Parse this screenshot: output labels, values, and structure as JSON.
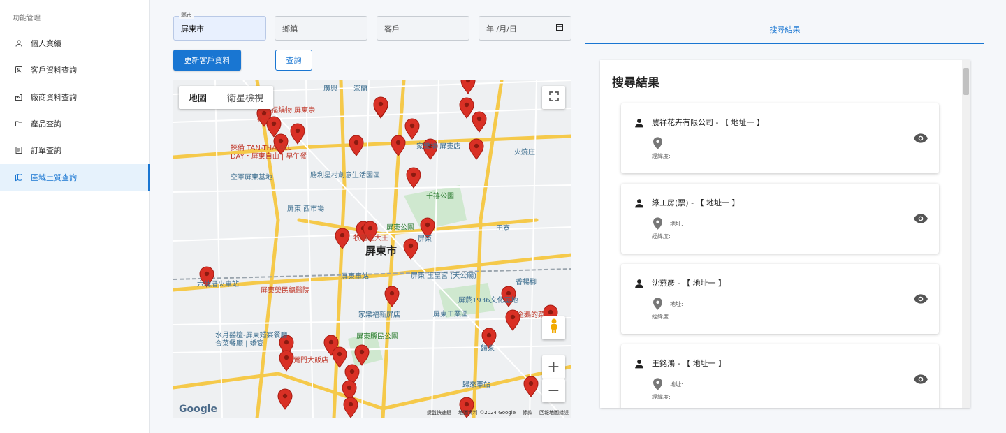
{
  "sidebar": {
    "header": "功能管理",
    "items": [
      {
        "label": "個人業績",
        "icon": "person-icon"
      },
      {
        "label": "客戶資料查詢",
        "icon": "contact-card-icon"
      },
      {
        "label": "廠商資料查詢",
        "icon": "factory-icon"
      },
      {
        "label": "產品查詢",
        "icon": "folder-icon"
      },
      {
        "label": "訂單查詢",
        "icon": "document-icon"
      },
      {
        "label": "區域土質查詢",
        "icon": "map-icon",
        "active": true
      }
    ]
  },
  "form": {
    "county_label": "縣市",
    "county_value": "屏東市",
    "township_placeholder": "鄉鎮",
    "customer_placeholder": "客戶",
    "date_placeholder": "年 /月/日",
    "update_button": "更新客戶資料",
    "query_button": "查詢"
  },
  "map": {
    "tab_map": "地圖",
    "tab_satellite": "衛星檢視",
    "zoom_in": "+",
    "zoom_out": "−",
    "google_logo": "Google",
    "footer": [
      "鍵盤快速鍵",
      "地圖資料 ©2024 Google",
      "條款",
      "回報地圖錯誤"
    ],
    "labels": {
      "city": "屏東市",
      "station": "屏東車站",
      "park": "屏東公園",
      "xisi_market": "屏東 西市場",
      "hospital": "屏東榮民總醫院",
      "kanghe": "千禧公園",
      "jiale": "家樂福新屏店",
      "industrial": "屏東工業區",
      "guilai_station": "歸來車站",
      "shengli": "勝利星村創意生活園區",
      "base": "空軍屏東基地",
      "pingtung": "屏東",
      "yuhuang": "屏東 玉皇宮 (天公廟)",
      "pinggan": "屏菸1936文化基地",
      "county_park": "屏東縣民公園",
      "dawu_restaurant": "水月囍檀-屏東婚宴餐廳 | 合菜餐廳 | 婚宴",
      "guilai": "歸來",
      "xiangyang": "香楊腳",
      "huoshao": "火燒庄",
      "tianliao": "田寮",
      "guangxing": "廣興",
      "chongding": "崇蘭",
      "liukuai": "六塊厝火車站",
      "tanbei": "探備 TAN-THA ALL DAY・屏東自由 | 早午餐",
      "wanjia": "萬家福鍋物 屏東崇朝店",
      "carrefour": "家樂福 屏東店",
      "yinghua": "鶯門大飯店",
      "qinshui": "企鵝的菜",
      "kuangmao": "牧場乳大王"
    }
  },
  "results": {
    "tab_label": "搜尋結果",
    "title": "搜尋結果",
    "address_label": "地址:",
    "coord_label": "經緯度:",
    "cards": [
      {
        "name": "農祥花卉有限公司 - 【 地址一 】",
        "has_address": false
      },
      {
        "name": "綠工房(票) - 【 地址一 】",
        "has_address": true
      },
      {
        "name": "沈燕彥 - 【 地址一 】",
        "has_address": true
      },
      {
        "name": "王銘鴻 - 【 地址一 】",
        "has_address": true
      }
    ]
  },
  "colors": {
    "accent": "#1976d2",
    "marker": "#d93025",
    "active_bg": "#e6f2fc"
  }
}
